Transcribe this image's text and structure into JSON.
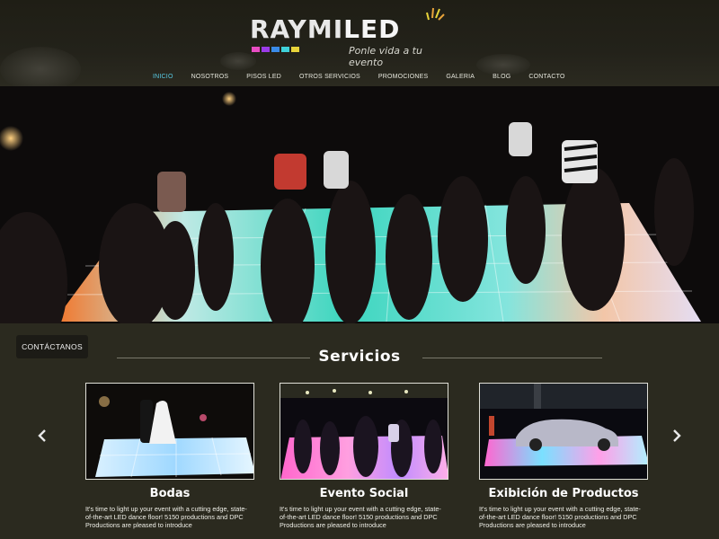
{
  "brand": {
    "name_part1": "RAYMI",
    "name_part2": "LED",
    "tagline": "Ponle vida a tu evento",
    "logo_square_colors": [
      "#e84cc2",
      "#9b3be8",
      "#3a8be8",
      "#3fd1d9",
      "#e8d43a"
    ]
  },
  "nav": {
    "items": [
      {
        "label": "INICIO",
        "active": true
      },
      {
        "label": "NOSOTROS",
        "active": false
      },
      {
        "label": "PISOS LED",
        "active": false
      },
      {
        "label": "OTROS SERVICIOS",
        "active": false
      },
      {
        "label": "PROMOCIONES",
        "active": false
      },
      {
        "label": "GALERIA",
        "active": false
      },
      {
        "label": "BLOG",
        "active": false
      },
      {
        "label": "CONTACTO",
        "active": false
      }
    ]
  },
  "contact_tab": {
    "label": "CONTÁCTANOS"
  },
  "services": {
    "title": "Servicios",
    "prev_icon": "chevron-left-icon",
    "next_icon": "chevron-right-icon",
    "cards": [
      {
        "title": "Bodas",
        "text": "It's time to light up your event with a cutting edge, state-of-the-art LED dance floor! 5150 productions and DPC Productions are pleased to introduce"
      },
      {
        "title": "Evento Social",
        "text": "It's time to light up your event with a cutting edge, state-of-the-art LED dance floor! 5150 productions and DPC Productions are pleased to introduce"
      },
      {
        "title": "Exibición de Productos",
        "text": "It's time to light up your event with a cutting edge, state-of-the-art LED dance floor! 5150 productions and DPC Productions are pleased to introduce"
      }
    ]
  },
  "colors": {
    "background": "#2b2a1f",
    "accent": "#58c9e3"
  }
}
